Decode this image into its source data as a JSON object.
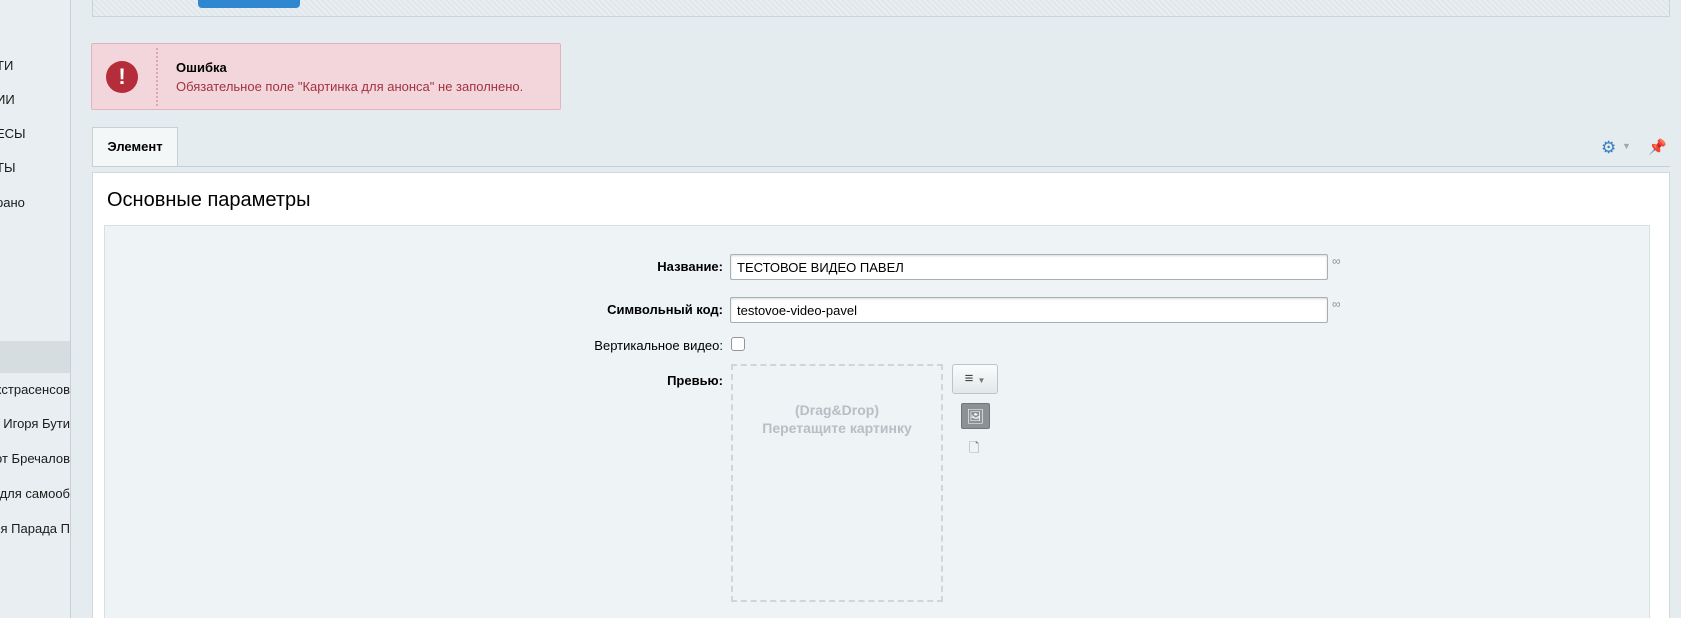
{
  "sidebar": {
    "top_items": [
      "ТИ",
      "ИИ",
      "ЕСЫ",
      "ТЫ",
      "рано"
    ],
    "sub_items": [
      "экстрасенсов",
      "т Игоря Бути",
      "от Бречалов",
      "для самооб",
      "ция Парада П"
    ]
  },
  "error": {
    "icon": "!",
    "title": "Ошибка",
    "message": "Обязательное поле \"Картинка для анонса\" не заполнено."
  },
  "tabs": {
    "active": "Элемент"
  },
  "icons": {
    "settings": "gear-icon",
    "pin": "pin-icon"
  },
  "section": {
    "title": "Основные параметры"
  },
  "form": {
    "name_label": "Название:",
    "name_value": "ТЕСТОВОЕ ВИДЕО ПАВЕЛ",
    "code_label": "Символьный код:",
    "code_value": "testovoe-video-pavel",
    "vertical_label": "Вертикальное видео:",
    "vertical_checked": false,
    "preview_label": "Превью:",
    "dropzone_line1": "(Drag&Drop)",
    "dropzone_line2": "Перетащите картинку"
  },
  "colors": {
    "error_bg": "#f3d6db",
    "error_text": "#a33240",
    "error_icon": "#b52c3a",
    "accent": "#2f86d1"
  }
}
